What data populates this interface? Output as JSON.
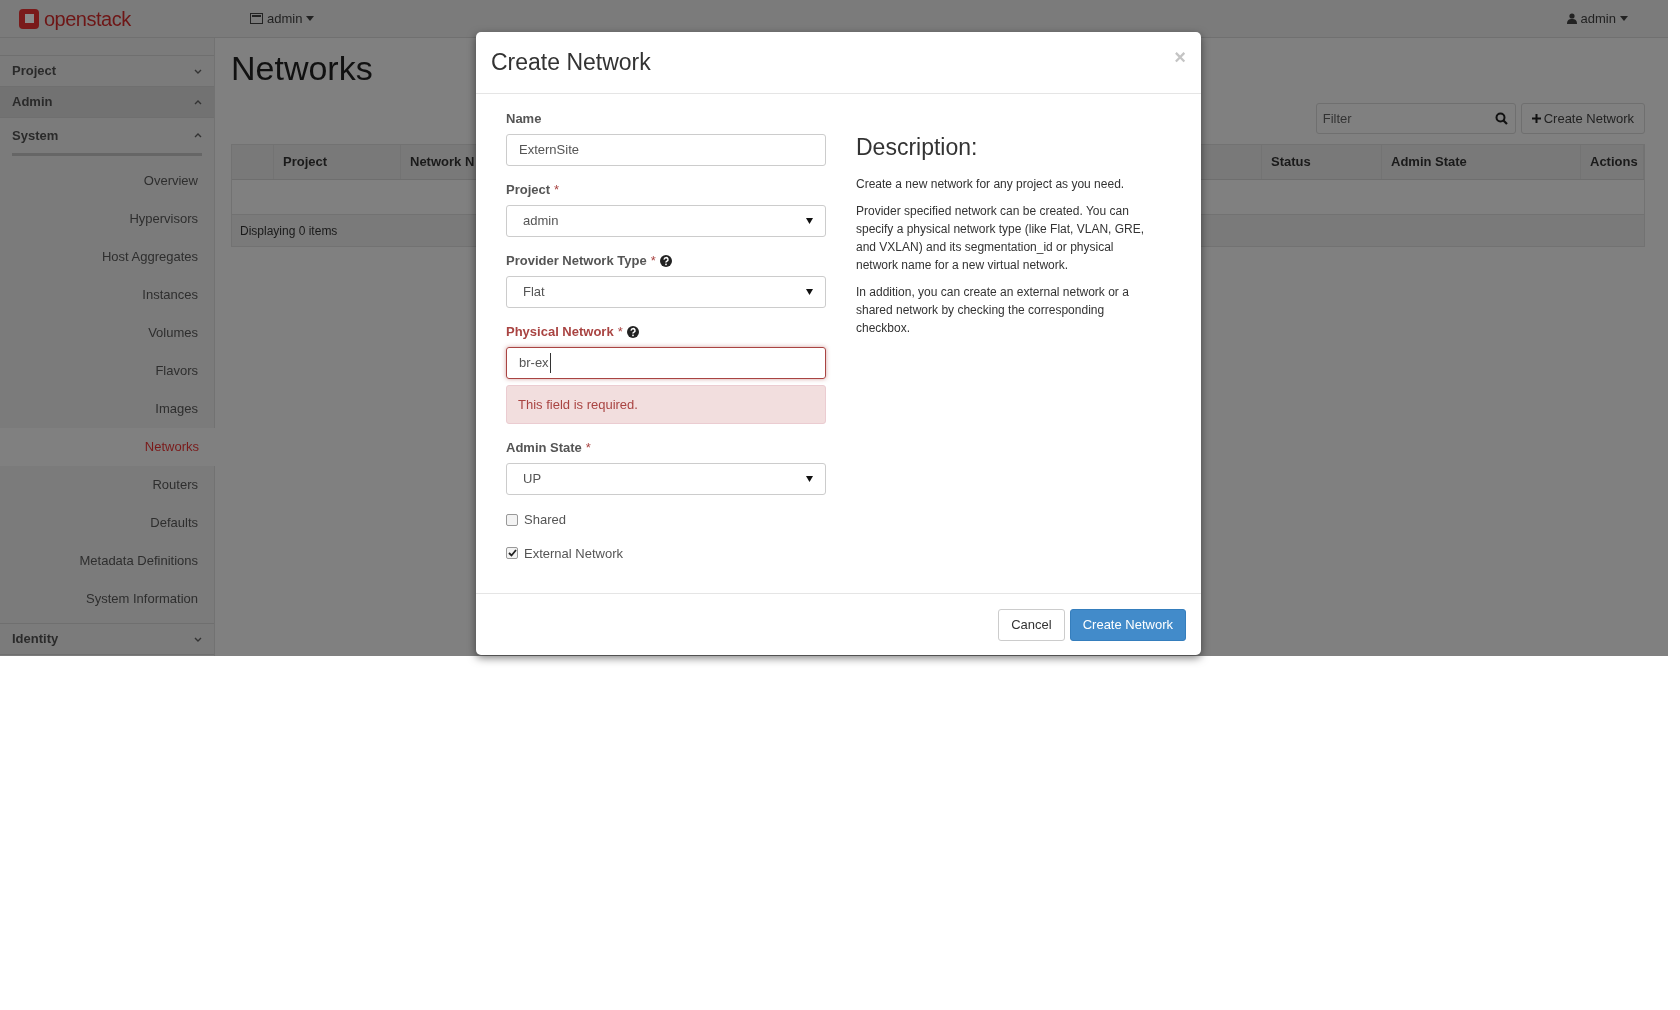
{
  "header": {
    "logo_text": "openstack",
    "project_menu": "admin",
    "user_menu": "admin"
  },
  "sidebar": [
    {
      "label": "Project",
      "expanded": false
    },
    {
      "label": "Admin",
      "expanded": true,
      "children": [
        {
          "label": "System",
          "expanded": true,
          "children": [
            {
              "label": "Overview",
              "selected": false
            },
            {
              "label": "Hypervisors",
              "selected": false
            },
            {
              "label": "Host Aggregates",
              "selected": false
            },
            {
              "label": "Instances",
              "selected": false
            },
            {
              "label": "Volumes",
              "selected": false
            },
            {
              "label": "Flavors",
              "selected": false
            },
            {
              "label": "Images",
              "selected": false
            },
            {
              "label": "Networks",
              "selected": true
            },
            {
              "label": "Routers",
              "selected": false
            },
            {
              "label": "Defaults",
              "selected": false
            },
            {
              "label": "Metadata Definitions",
              "selected": false
            },
            {
              "label": "System Information",
              "selected": false
            }
          ]
        }
      ]
    },
    {
      "label": "Identity",
      "expanded": false
    }
  ],
  "page_title": "Networks",
  "toolbar": {
    "filter_placeholder": "Filter",
    "create_button": "Create Network"
  },
  "table": {
    "columns": [
      "Project",
      "Network N",
      "Status",
      "Admin State",
      "Actions"
    ],
    "footer": "Displaying 0 items"
  },
  "modal": {
    "title": "Create Network",
    "close": "×",
    "fields": [
      {
        "kind": "text",
        "label": "Name",
        "value": "ExternSite"
      },
      {
        "kind": "select",
        "label": "Project",
        "required_mark": "*",
        "value": "admin"
      },
      {
        "kind": "select",
        "label": "Provider Network Type",
        "required_mark": "*",
        "help": true,
        "value": "Flat"
      },
      {
        "kind": "text",
        "label": "Physical Network",
        "required_mark": "*",
        "help": true,
        "value": "br-ex",
        "error": "This field is required."
      },
      {
        "kind": "select",
        "label": "Admin State",
        "required_mark": "*",
        "value": "UP"
      }
    ],
    "checkboxes": [
      {
        "label": "Shared",
        "checked": false
      },
      {
        "label": "External Network",
        "checked": true
      }
    ],
    "description": {
      "heading": "Description:",
      "paragraphs": [
        "Create a new network for any project as you need.",
        "Provider specified network can be created. You can specify a physical network type (like Flat, VLAN, GRE, and VXLAN) and its segmentation_id or physical network name for a new virtual network.",
        "In addition, you can create an external network or a shared network by checking the corresponding checkbox."
      ]
    },
    "buttons": {
      "cancel": "Cancel",
      "submit": "Create Network"
    }
  }
}
